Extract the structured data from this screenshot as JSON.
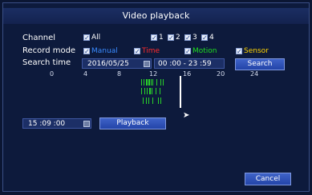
{
  "title": "Video playback",
  "channel": {
    "label": "Channel",
    "all_label": "All",
    "items": [
      "1",
      "2",
      "3",
      "4"
    ]
  },
  "record_mode": {
    "label": "Record mode",
    "items": [
      {
        "label": "Manual",
        "color": "#3a8bff"
      },
      {
        "label": "Time",
        "color": "#ff2a2a"
      },
      {
        "label": "Motion",
        "color": "#1fe01f"
      },
      {
        "label": "Sensor",
        "color": "#ffd400"
      }
    ]
  },
  "search_time": {
    "label": "Search time",
    "date": "2016/05/25",
    "time_range": "00 :00  -  23 :59",
    "search_button": "Search"
  },
  "timeline": {
    "ticks": [
      "0",
      "4",
      "8",
      "12",
      "16",
      "20",
      "24"
    ],
    "record_color": "#29d329",
    "marker_color": "#ffffff"
  },
  "playback": {
    "time_value": "15 :09 :00",
    "button": "Playback"
  },
  "cancel_button": "Cancel",
  "icons": {
    "checkbox": "checkmark-icon",
    "calendar": "calendar-icon",
    "cursor": "mouse-pointer-icon"
  }
}
